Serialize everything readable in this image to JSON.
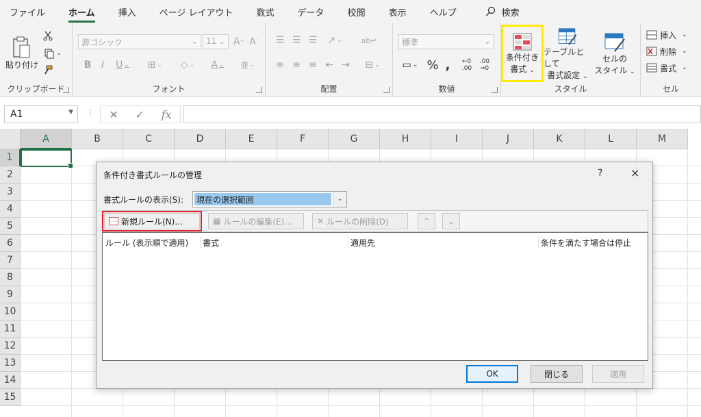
{
  "tabs": [
    "ファイル",
    "ホーム",
    "挿入",
    "ページ レイアウト",
    "数式",
    "データ",
    "校閲",
    "表示",
    "ヘルプ"
  ],
  "active_tab": "ホーム",
  "search_label": "検索",
  "ribbon": {
    "clipboard": {
      "paste": "貼り付け",
      "label": "クリップボード"
    },
    "font": {
      "name": "游ゴシック",
      "size": "11",
      "label": "フォント"
    },
    "alignment": {
      "label": "配置"
    },
    "number": {
      "format": "標準",
      "label": "数値"
    },
    "styles": {
      "conditional": [
        "条件付き",
        "書式"
      ],
      "table": [
        "テーブルとして",
        "書式設定"
      ],
      "cell": [
        "セルの",
        "スタイル"
      ],
      "label": "スタイル"
    },
    "cells": {
      "insert": "挿入",
      "delete": "削除",
      "format": "書式",
      "label": "セル"
    }
  },
  "formula_bar": {
    "name_box": "A1",
    "fx": "fx"
  },
  "grid": {
    "columns": [
      "A",
      "B",
      "C",
      "D",
      "E",
      "F",
      "G",
      "H",
      "I",
      "J",
      "K",
      "L",
      "M"
    ],
    "rows": [
      "1",
      "2",
      "3",
      "4",
      "5",
      "6",
      "7",
      "8",
      "9",
      "10",
      "11",
      "12",
      "13",
      "14",
      "15"
    ],
    "selected_col": "A",
    "selected_row": "1"
  },
  "dialog": {
    "title": "条件付き書式ルールの管理",
    "help": "?",
    "close": "×",
    "show_label": "書式ルールの表示(S):",
    "show_value": "現在の選択範囲",
    "new_rule": "新規ルール(N)...",
    "edit_rule": "ルールの編集(E)...",
    "delete_rule": "ルールの削除(D)",
    "columns": [
      "ルール (表示順で適用)",
      "書式",
      "適用先",
      "条件を満たす場合は停止"
    ],
    "ok": "OK",
    "close_btn": "閉じる",
    "apply": "適用"
  },
  "colors": {
    "accent": "#217346",
    "highlight_yellow": "#ffea00",
    "highlight_red": "#e0202c",
    "selection_blue": "#99c9ef"
  }
}
